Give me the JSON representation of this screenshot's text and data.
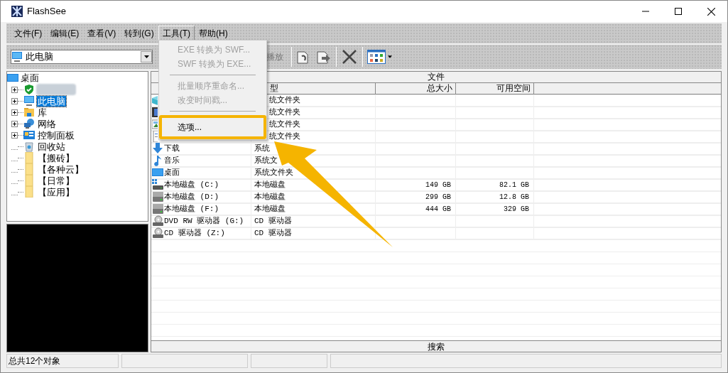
{
  "window": {
    "title": "FlashSee"
  },
  "menu_bar": [
    {
      "label": "文件(F)",
      "selected": false
    },
    {
      "label": "编辑(E)",
      "selected": false
    },
    {
      "label": "查看(V)",
      "selected": false
    },
    {
      "label": "转到(G)",
      "selected": false
    },
    {
      "label": "工具(T)",
      "selected": true
    },
    {
      "label": "帮助(H)",
      "selected": false
    }
  ],
  "toolbar": {
    "location": "此电脑",
    "partial_button": "播放"
  },
  "dropdown_menu": {
    "items": [
      {
        "kind": "item",
        "label": "EXE 转换为 SWF...",
        "disabled": true,
        "annotated": false
      },
      {
        "kind": "item",
        "label": "SWF 转换为 EXE...",
        "disabled": true,
        "annotated": false
      },
      {
        "kind": "separator"
      },
      {
        "kind": "item",
        "label": "批量顺序重命名...",
        "disabled": true,
        "annotated": false
      },
      {
        "kind": "item",
        "label": "改变时间戳...",
        "disabled": true,
        "annotated": false
      },
      {
        "kind": "separator"
      },
      {
        "kind": "item",
        "label": "选项...",
        "disabled": false,
        "annotated": true
      }
    ]
  },
  "tree": {
    "label": "桌面",
    "children": [
      {
        "has_children": true,
        "selected": false
      },
      {
        "label": "此电脑",
        "has_children": true,
        "selected": true
      },
      {
        "label": "库",
        "has_children": true,
        "selected": false
      },
      {
        "label": "网络",
        "has_children": true,
        "selected": false
      },
      {
        "label": "控制面板",
        "has_children": true,
        "selected": false
      },
      {
        "label": "回收站",
        "has_children": false,
        "selected": false
      },
      {
        "label": "【搬砖】",
        "has_children": false,
        "selected": false
      },
      {
        "label": "【各种云】",
        "has_children": false,
        "selected": false
      },
      {
        "label": "【日常】",
        "has_children": false,
        "selected": false
      },
      {
        "label": "【应用】",
        "has_children": false,
        "selected": false
      }
    ]
  },
  "file_list": {
    "group_header": "文件",
    "columns": [
      "型",
      "总大小",
      "可用空间"
    ],
    "rows": [
      {
        "type": "统文件夹"
      },
      {
        "type": "统文件夹"
      },
      {
        "type": "统文件夹"
      },
      {
        "type": "统文件夹"
      },
      {
        "name": "下载",
        "type": "系统"
      },
      {
        "name": "音乐",
        "type": "系统文"
      },
      {
        "name": "桌面",
        "type": "系统文件夹"
      },
      {
        "name": "本地磁盘 (C:)",
        "type": "本地磁盘",
        "total": "149 GB",
        "free": "82.1 GB"
      },
      {
        "name": "本地磁盘 (D:)",
        "type": "本地磁盘",
        "total": "299 GB",
        "free": "12.8 GB"
      },
      {
        "name": "本地磁盘 (F:)",
        "type": "本地磁盘",
        "total": "444 GB",
        "free": "329 GB"
      },
      {
        "name": "DVD RW 驱动器 (G:)",
        "type": "CD 驱动器"
      },
      {
        "name": "CD 驱动器 (Z:)",
        "type": "CD 驱动器"
      }
    ]
  },
  "search_button": "搜索",
  "status_bar": [
    "总共12个对象"
  ]
}
